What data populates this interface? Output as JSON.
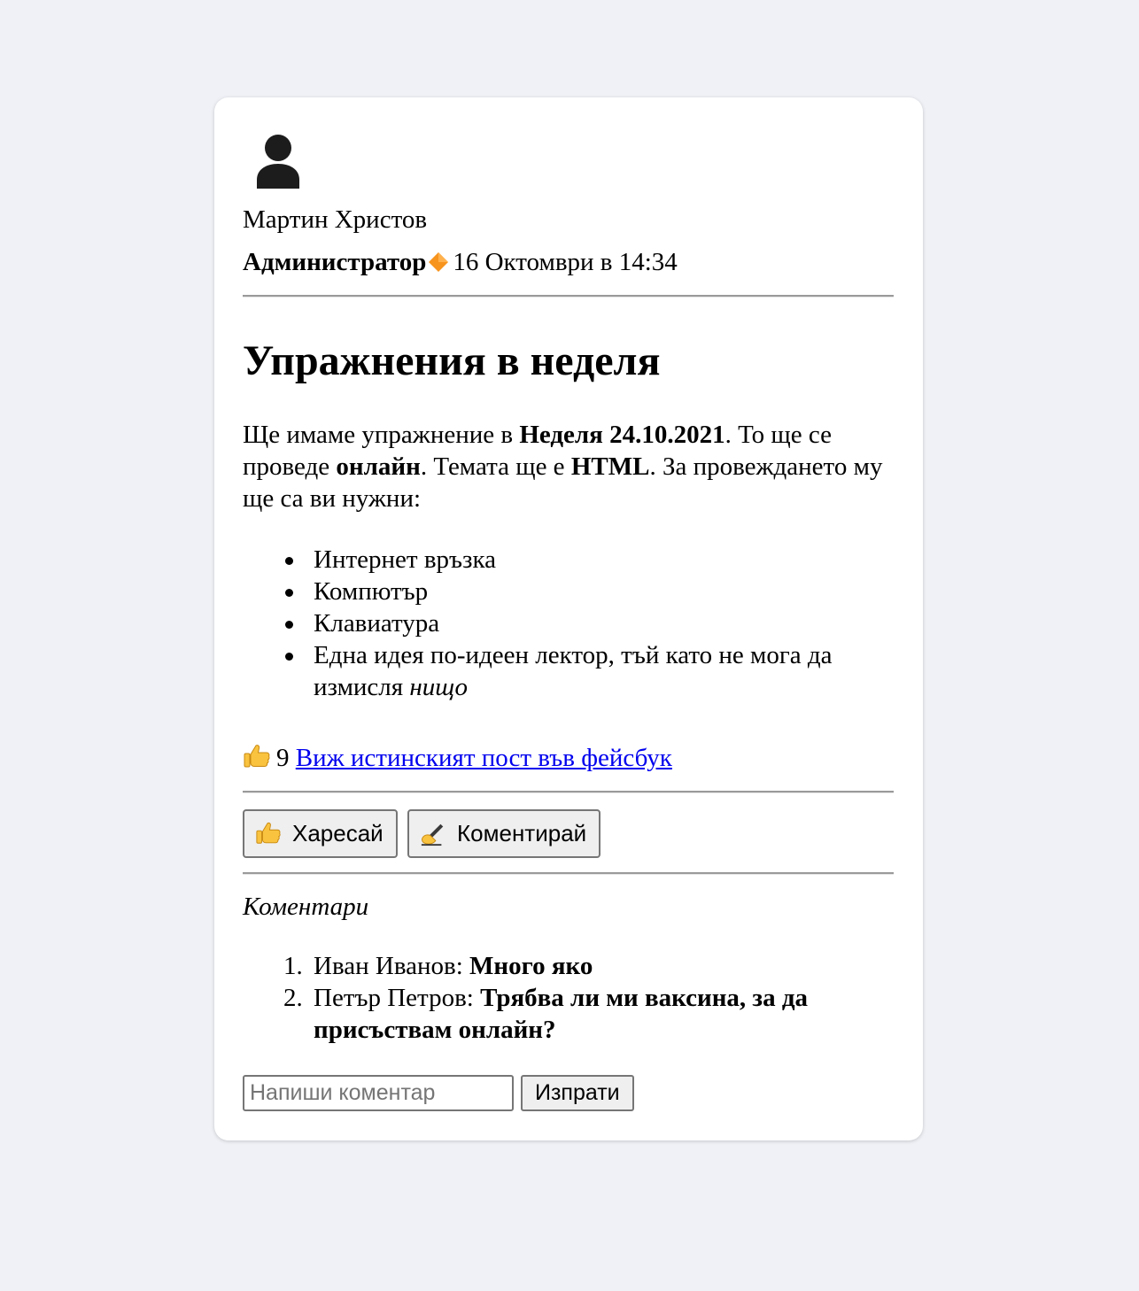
{
  "post": {
    "author": {
      "avatar_icon": "user-silhouette-icon",
      "name": "Мартин Христов",
      "role": "Администратор",
      "role_badge_icon": "orange-diamond-icon",
      "timestamp": "16 Октомври в 14:34"
    },
    "title": "Упражнения в неделя",
    "body": {
      "p1": "Ще имаме упражнение в ",
      "b1": "Неделя 24.10.2021",
      "p2": ". То ще се проведе ",
      "b2": "онлайн",
      "p3": ". Темата ще е ",
      "b3": "HTML",
      "p4": ". За провеждането му ще са ви нужни:"
    },
    "needs": [
      "Интернет връзка",
      "Компютър",
      "Клавиатура"
    ],
    "needs_last": {
      "text": "Една идея по-идеен лектор, тъй като не мога да измисля ",
      "italic": "нищо"
    },
    "likes": {
      "icon": "thumbs-up-icon",
      "count": "9",
      "link_text": "Виж истинският пост във фейсбук"
    },
    "actions": {
      "like_icon": "thumbs-up-icon",
      "like_label": "Харесай",
      "comment_icon": "writing-hand-icon",
      "comment_label": "Коментирай"
    },
    "comments_title": "Коментари",
    "comments": [
      {
        "num": "1.",
        "author": "Иван Иванов: ",
        "text": "Много яко"
      },
      {
        "num": "2.",
        "author": "Петър Петров: ",
        "text": "Трябва ли ми ваксина, за да присъствам онлайн?"
      }
    ],
    "comment_form": {
      "placeholder": "Напиши коментар",
      "value": "",
      "submit_label": "Изпрати"
    }
  },
  "colors": {
    "page_background": "#eff1f6",
    "card_background": "#ffffff",
    "link": "#0000ee",
    "button_background": "#efefef",
    "badge_orange": "#f7941d"
  }
}
